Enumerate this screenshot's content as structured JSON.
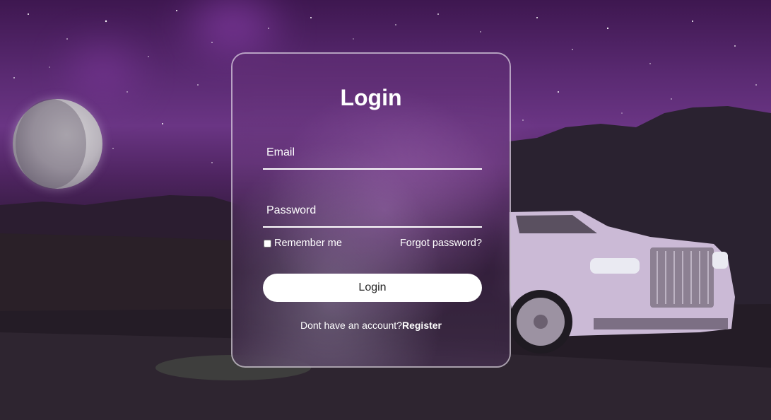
{
  "login": {
    "title": "Login",
    "email_placeholder": "Email",
    "password_placeholder": "Password",
    "remember_label": "Remember me",
    "forgot_label": "Forgot password?",
    "button_label": "Login",
    "register_prompt": "Dont have an account?",
    "register_link": "Register"
  },
  "colors": {
    "accent": "#ffffff",
    "background_sky": "#5a2a72",
    "card_border": "#d8c8e0"
  },
  "icons": {
    "checkbox": "checkbox-icon"
  }
}
